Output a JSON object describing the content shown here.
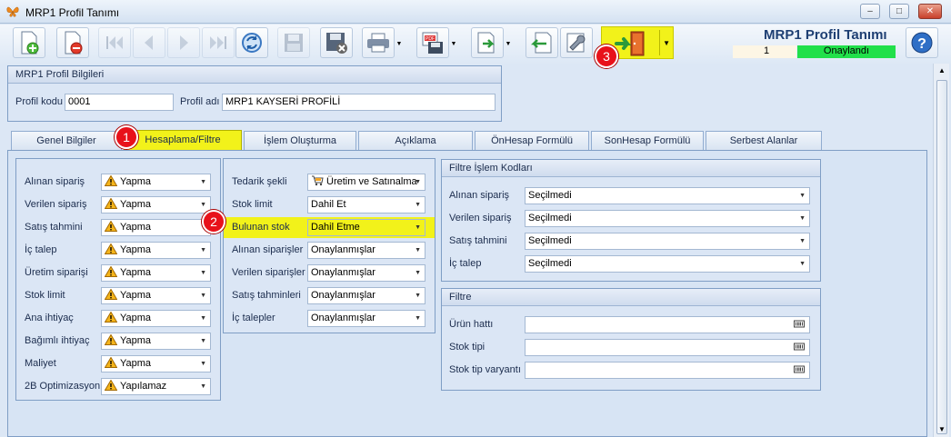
{
  "window": {
    "title": "MRP1 Profil Tanımı",
    "minimize": "–",
    "maximize": "□",
    "close": "✕"
  },
  "header": {
    "title": "MRP1 Profil Tanımı",
    "number": "1",
    "status": "Onaylandı",
    "help": "?"
  },
  "profile": {
    "group_title": "MRP1 Profil Bilgileri",
    "code_label": "Profil kodu",
    "code_value": "0001",
    "name_label": "Profil adı",
    "name_value": "MRP1 KAYSERİ PROFİLİ"
  },
  "tabs": [
    "Genel Bilgiler",
    "Hesaplama/Filtre",
    "İşlem Oluşturma",
    "Açıklama",
    "ÖnHesap Formülü",
    "SonHesap Formülü",
    "Serbest Alanlar"
  ],
  "badges": [
    "1",
    "2",
    "3"
  ],
  "left_fields": [
    {
      "label": "Alınan sipariş",
      "value": "Yapma"
    },
    {
      "label": "Verilen sipariş",
      "value": "Yapma"
    },
    {
      "label": "Satış tahmini",
      "value": "Yapma"
    },
    {
      "label": "İç talep",
      "value": "Yapma"
    },
    {
      "label": "Üretim siparişi",
      "value": "Yapma"
    },
    {
      "label": "Stok limit",
      "value": "Yapma"
    },
    {
      "label": "Ana ihtiyaç",
      "value": "Yapma"
    },
    {
      "label": "Bağımlı ihtiyaç",
      "value": "Yapma"
    },
    {
      "label": "Maliyet",
      "value": "Yapma"
    },
    {
      "label": "2B Optimizasyon",
      "value": "Yapılamaz"
    }
  ],
  "mid_fields": [
    {
      "label": "Tedarik şekli",
      "value": "Üretim ve Satınalma"
    },
    {
      "label": "Stok limit",
      "value": "Dahil Et"
    },
    {
      "label": "Bulunan stok",
      "value": "Dahil Etme"
    },
    {
      "label": "Alınan siparişler",
      "value": "Onaylanmışlar"
    },
    {
      "label": "Verilen siparişler",
      "value": "Onaylanmışlar"
    },
    {
      "label": "Satış tahminleri",
      "value": "Onaylanmışlar"
    },
    {
      "label": "İç talepler",
      "value": "Onaylanmışlar"
    }
  ],
  "filter_codes": {
    "title": "Filtre İşlem Kodları",
    "fields": [
      {
        "label": "Alınan sipariş",
        "value": "Seçilmedi"
      },
      {
        "label": "Verilen sipariş",
        "value": "Seçilmedi"
      },
      {
        "label": "Satış tahmini",
        "value": "Seçilmedi"
      },
      {
        "label": "İç talep",
        "value": "Seçilmedi"
      }
    ]
  },
  "filter": {
    "title": "Filtre",
    "fields": [
      {
        "label": "Ürün hattı",
        "value": ""
      },
      {
        "label": "Stok tipi",
        "value": ""
      },
      {
        "label": "Stok tip varyantı",
        "value": ""
      }
    ]
  },
  "colors": {
    "highlight": "#f2f21a",
    "status_green": "#21e04a",
    "badge_red": "#e8111a"
  }
}
